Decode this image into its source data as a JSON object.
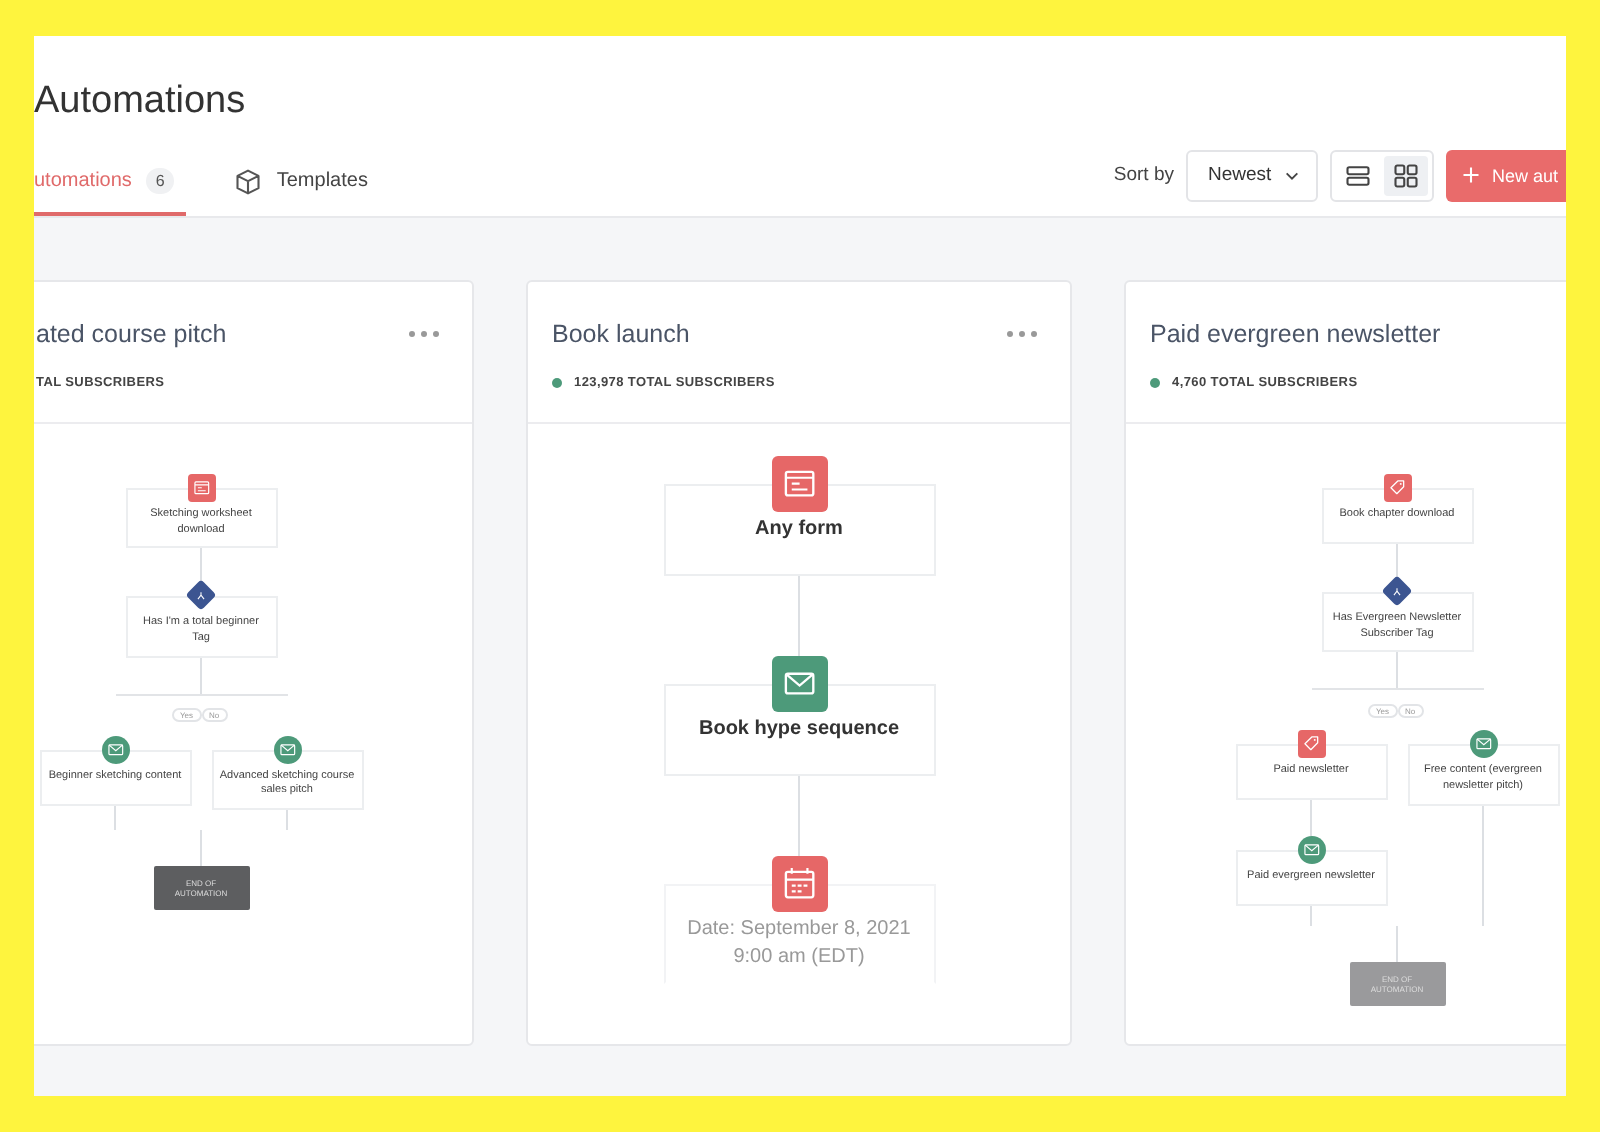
{
  "header": {
    "title": "Automations"
  },
  "tabs": [
    {
      "label": "utomations",
      "count": "6",
      "kind": "plain",
      "selected": true
    },
    {
      "label": "Templates",
      "kind": "cube",
      "selected": false
    }
  ],
  "toolbar": {
    "sort_label": "Sort by",
    "sort_value": "Newest",
    "view_options": [
      {
        "kind": "list",
        "selected": false
      },
      {
        "kind": "grid",
        "selected": true
      }
    ],
    "new_button": "New aut"
  },
  "cards": [
    {
      "title": "ated course pitch",
      "subscribers": "TAL SUBSCRIBERS",
      "dot": false,
      "menu": true,
      "kind": "compact",
      "steps": [
        {
          "kind": "form",
          "label": "Sketching worksheet download"
        },
        {
          "kind": "condition",
          "label": "Has I'm a total beginner Tag"
        },
        {
          "kind": "branch",
          "paths": [
            {
              "label": "Yes",
              "steps": [
                {
                  "kind": "email",
                  "label": "Beginner sketching content"
                }
              ]
            },
            {
              "label": "No",
              "steps": [
                {
                  "kind": "email",
                  "label": "Advanced sketching course sales pitch"
                }
              ]
            }
          ]
        },
        {
          "kind": "end",
          "label": "END OF AUTOMATION"
        }
      ]
    },
    {
      "title": "Book launch",
      "subscribers": "123,978 TOTAL SUBSCRIBERS",
      "dot": true,
      "menu": true,
      "kind": "expanded",
      "steps": [
        {
          "kind": "form",
          "label": "Any form"
        },
        {
          "kind": "email",
          "label": "Book hype sequence"
        },
        {
          "kind": "date",
          "label": "Date: September 8, 2021",
          "sublabel": "9:00 am (EDT)"
        }
      ]
    },
    {
      "title": "Paid evergreen newsletter",
      "subscribers": "4,760 TOTAL SUBSCRIBERS",
      "dot": true,
      "menu": false,
      "kind": "compact",
      "steps": [
        {
          "kind": "tag",
          "label": "Book chapter download"
        },
        {
          "kind": "condition",
          "label": "Has Evergreen Newsletter Subscriber Tag"
        },
        {
          "kind": "branch",
          "paths": [
            {
              "label": "Yes",
              "steps": [
                {
                  "kind": "tag",
                  "label": "Paid newsletter"
                },
                {
                  "kind": "email",
                  "label": "Paid evergreen newsletter"
                }
              ]
            },
            {
              "label": "No",
              "steps": [
                {
                  "kind": "email",
                  "label": "Free content (evergreen newsletter pitch)"
                }
              ]
            }
          ]
        },
        {
          "kind": "end",
          "label": "END OF AUTOMATION"
        }
      ]
    }
  ]
}
